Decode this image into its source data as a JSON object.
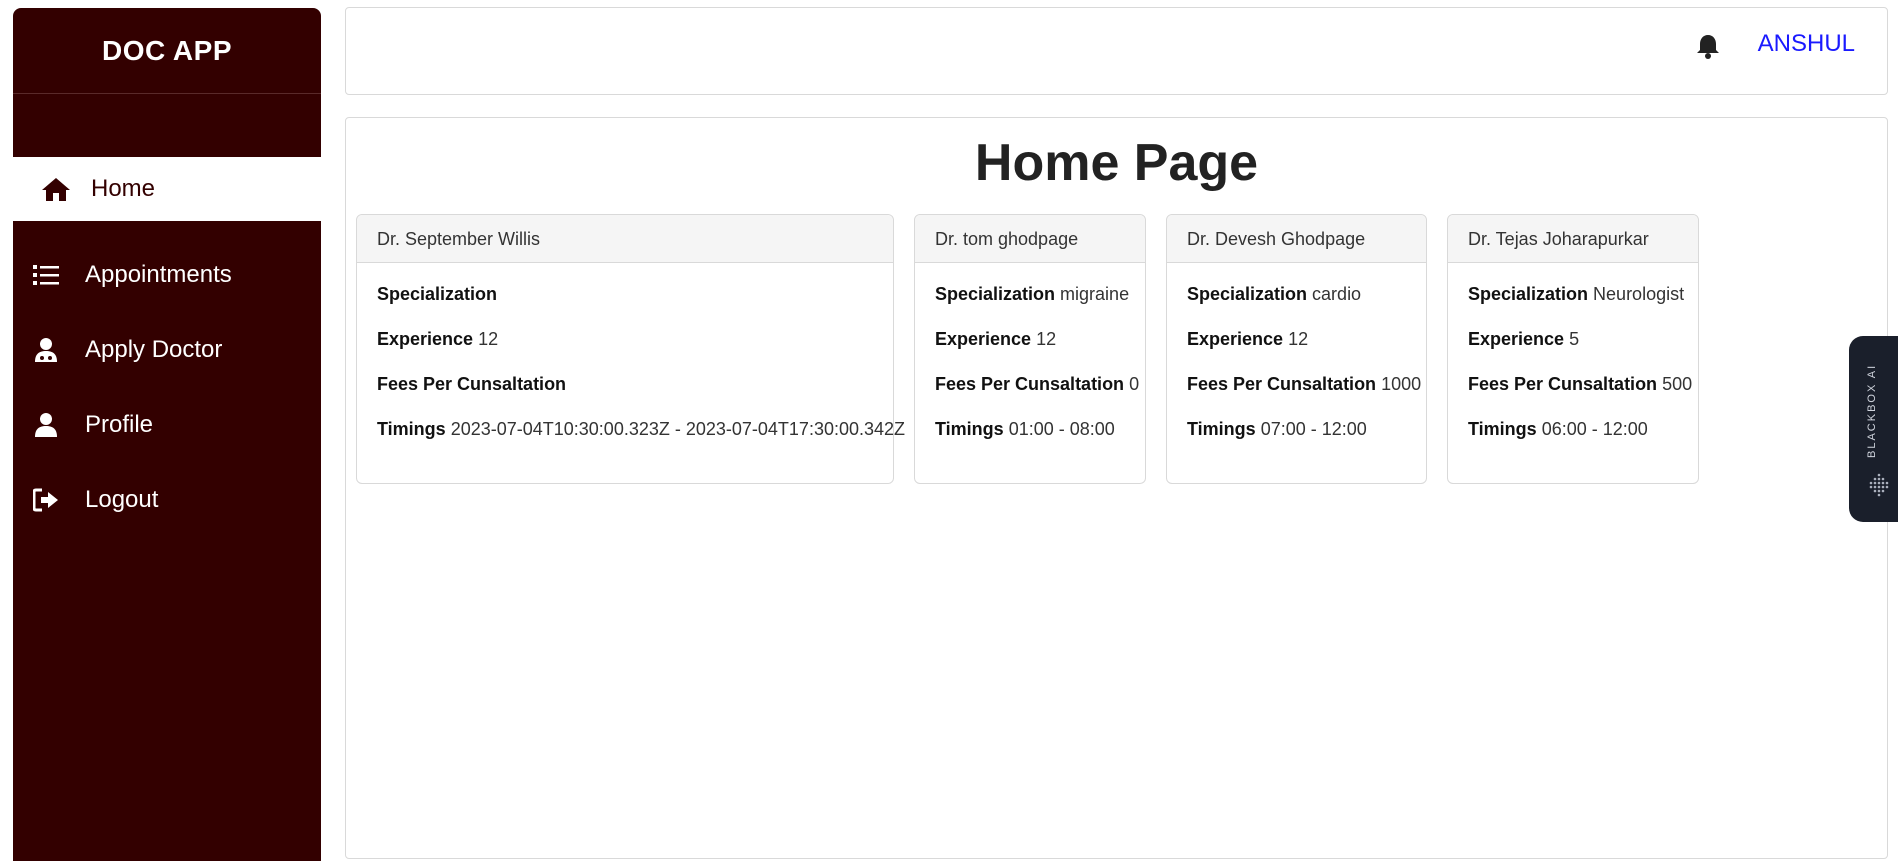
{
  "app": {
    "title": "DOC APP"
  },
  "sidebar": {
    "items": [
      {
        "label": "Home",
        "icon": "home-icon",
        "active": true
      },
      {
        "label": "Appointments",
        "icon": "list-icon",
        "active": false
      },
      {
        "label": "Apply Doctor",
        "icon": "user-doctor-icon",
        "active": false
      },
      {
        "label": "Profile",
        "icon": "user-icon",
        "active": false
      },
      {
        "label": "Logout",
        "icon": "logout-icon",
        "active": false
      }
    ]
  },
  "header": {
    "user_name": "ANSHUL",
    "bell_icon": "bell-icon"
  },
  "main": {
    "title": "Home Page",
    "labels": {
      "specialization": "Specialization",
      "experience": "Experience",
      "fees": "Fees Per Cunsaltation",
      "timings": "Timings"
    },
    "doctors": [
      {
        "name": "Dr. September Willis",
        "specialization": "",
        "experience": "12",
        "fees": "",
        "timings": "2023-07-04T10:30:00.323Z - 2023-07-04T17:30:00.342Z"
      },
      {
        "name": "Dr. tom ghodpage",
        "specialization": "migraine",
        "experience": "12",
        "fees": "0",
        "timings": "01:00 - 08:00"
      },
      {
        "name": "Dr. Devesh Ghodpage",
        "specialization": "cardio",
        "experience": "12",
        "fees": "1000",
        "timings": "07:00 - 12:00"
      },
      {
        "name": "Dr. Tejas Joharapurkar",
        "specialization": "Neurologist",
        "experience": "5",
        "fees": "500",
        "timings": "06:00 - 12:00"
      }
    ]
  },
  "widget": {
    "label": "BLACKBOX AI"
  },
  "colors": {
    "sidebar_bg": "#330000",
    "user_link": "#1a1aff"
  }
}
